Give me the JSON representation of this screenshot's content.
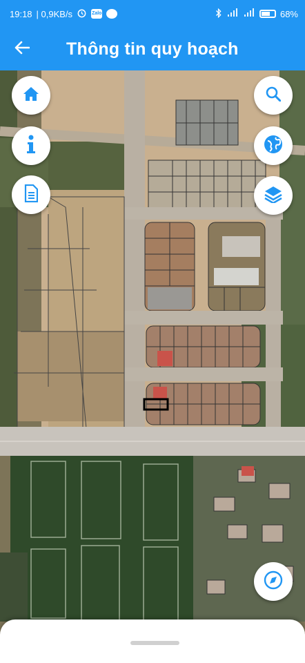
{
  "status_bar": {
    "time": "19:18",
    "network_speed": "| 0,9KB/s",
    "battery_percent": "68%",
    "icons": [
      "alarm-icon",
      "zalo-icon",
      "chrome-icon",
      "bluetooth-icon",
      "signal-4g-icon",
      "signal-icon",
      "battery-icon"
    ]
  },
  "app_bar": {
    "title": "Thông tin quy hoạch",
    "back_icon": "arrow-left-icon"
  },
  "map_controls": {
    "left": [
      "home-icon",
      "info-icon",
      "document-icon"
    ],
    "right": [
      "search-icon",
      "globe-icon",
      "layers-icon"
    ],
    "compass": "compass-icon"
  },
  "colors": {
    "primary": "#2196f3",
    "fab_icon": "#2196f3",
    "highlight_parcel": "#000000"
  }
}
